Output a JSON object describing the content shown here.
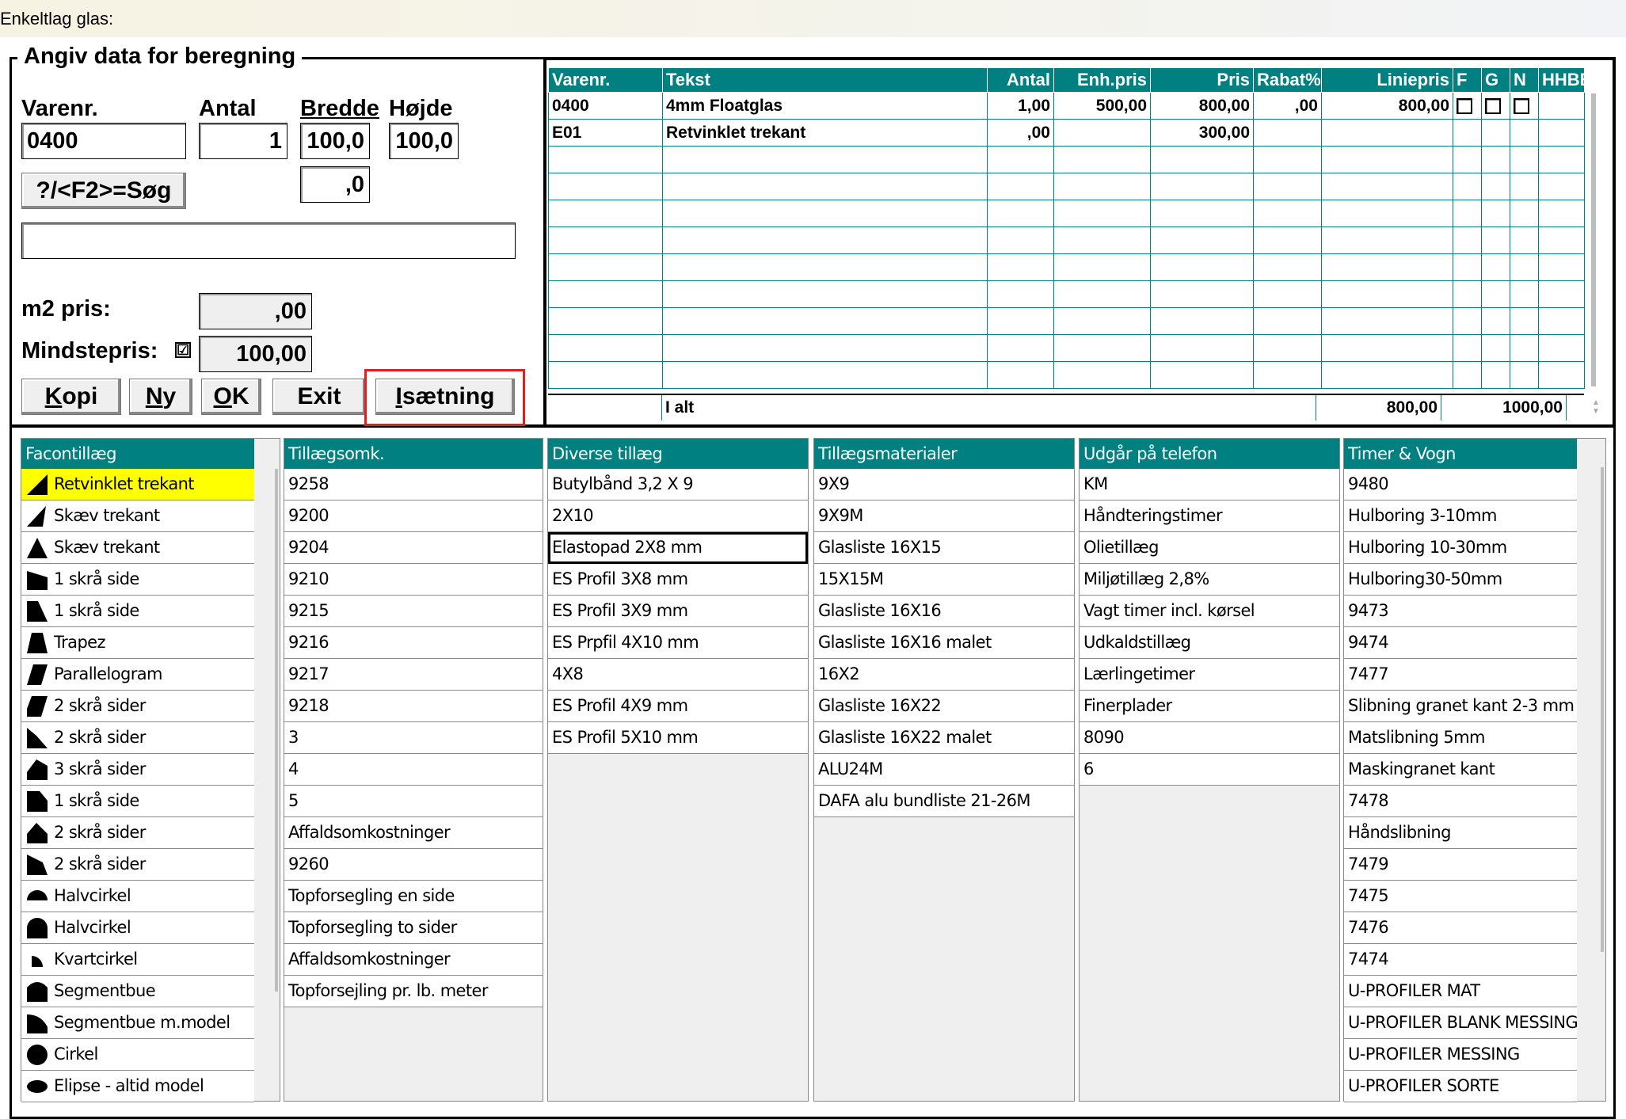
{
  "window": {
    "title": "Enkeltlag glas:"
  },
  "form": {
    "legend": "Angiv data for beregning",
    "labels": {
      "varenr": "Varenr.",
      "antal": "Antal",
      "bredde": "Bredde",
      "hojde": "Højde",
      "m2pris": "m2 pris:",
      "mindstepris": "Mindstepris:"
    },
    "values": {
      "varenr": "0400",
      "antal": "1",
      "bredde": "100,0",
      "hojde": "100,0",
      "extra": ",0",
      "note": "",
      "m2pris": ",00",
      "mindstepris": "100,00",
      "mindstepris_checked": "☑"
    },
    "buttons": {
      "search": "?/<F2>=Søg",
      "kopi": "Kopi",
      "ny": "Ny",
      "ok": "OK",
      "exit": "Exit",
      "isaetning": "Isætning"
    }
  },
  "grid": {
    "headers": [
      "Varenr.",
      "Tekst",
      "Antal",
      "Enh.pris",
      "Pris",
      "Rabat%",
      "Liniepris",
      "F",
      "G",
      "N",
      "HHBB"
    ],
    "rows": [
      {
        "varenr": "0400",
        "tekst": "4mm Floatglas",
        "antal": "1,00",
        "enhpris": "500,00",
        "pris": "800,00",
        "rabat": ",00",
        "liniepris": "800,00",
        "checks": true
      },
      {
        "varenr": "E01",
        "tekst": "Retvinklet trekant",
        "antal": ",00",
        "enhpris": "",
        "pris": "300,00",
        "rabat": "",
        "liniepris": "",
        "checks": false
      }
    ],
    "empty_rows": 9,
    "totals": {
      "label": "I alt",
      "sum1": "800,00",
      "sum2": "1000,00"
    }
  },
  "lists": {
    "facontillaeg": {
      "title": "Facontillæg",
      "items": [
        {
          "label": "Retvinklet trekant",
          "shape": "tri-right",
          "selected": true
        },
        {
          "label": "Skæv trekant",
          "shape": "tri-skew"
        },
        {
          "label": "Skæv trekant",
          "shape": "tri-iso"
        },
        {
          "label": "1 skrå side",
          "shape": "one-slant-a"
        },
        {
          "label": "1 skrå side",
          "shape": "one-slant-b"
        },
        {
          "label": "Trapez",
          "shape": "trapez"
        },
        {
          "label": "Parallelogram",
          "shape": "parallel"
        },
        {
          "label": "2 skrå sider",
          "shape": "two-slant-a"
        },
        {
          "label": "2 skrå sider",
          "shape": "two-slant-b"
        },
        {
          "label": "3 skrå sider",
          "shape": "three-slant"
        },
        {
          "label": "1 skrå side",
          "shape": "one-slant-c"
        },
        {
          "label": "2 skrå sider",
          "shape": "two-slant-c"
        },
        {
          "label": "2 skrå sider",
          "shape": "two-slant-d"
        },
        {
          "label": "Halvcirkel",
          "shape": "half-circle-flat"
        },
        {
          "label": "Halvcirkel",
          "shape": "half-circle"
        },
        {
          "label": "Kvartcirkel",
          "shape": "quarter-circle"
        },
        {
          "label": "Segmentbue",
          "shape": "segment"
        },
        {
          "label": "Segmentbue m.model",
          "shape": "segment-model"
        },
        {
          "label": "Cirkel",
          "shape": "circle"
        },
        {
          "label": "Elipse - altid model",
          "shape": "ellipse"
        }
      ]
    },
    "tillaegsomk": {
      "title": "Tillægsomk.",
      "items": [
        "9258",
        "9200",
        "9204",
        "9210",
        "9215",
        "9216",
        "9217",
        "9218",
        "3",
        "4",
        "5",
        "Affaldsomkostninger",
        "9260",
        "Topforsegling en side",
        "Topforsegling to sider",
        "Affaldsomkostninger",
        "Topforsejling pr. lb. meter"
      ]
    },
    "diverse": {
      "title": "Diverse tillæg",
      "items": [
        "Butylbånd 3,2 X 9",
        "2X10",
        "Elastopad 2X8 mm",
        "ES Profil 3X8 mm",
        "ES Profil 3X9 mm",
        "ES Prpfil 4X10 mm",
        "4X8",
        "ES Profil 4X9 mm",
        "ES Profil 5X10 mm"
      ],
      "focused_index": 2
    },
    "materialer": {
      "title": "Tillægsmaterialer",
      "items": [
        "9X9",
        "9X9M",
        "Glasliste 16X15",
        "15X15M",
        "Glasliste 16X16",
        "Glasliste 16X16 malet",
        "16X2",
        "Glasliste 16X22",
        "Glasliste 16X22 malet",
        "ALU24M",
        "DAFA alu bundliste 21-26M"
      ]
    },
    "telefon": {
      "title": "Udgår på telefon",
      "items": [
        "KM",
        "Håndteringstimer",
        "Olietillæg",
        "Miljøtillæg 2,8%",
        "Vagt timer incl. kørsel",
        "Udkaldstillæg",
        "Lærlingetimer",
        "Finerplader",
        "8090",
        "6"
      ]
    },
    "timer": {
      "title": "Timer & Vogn",
      "items": [
        "9480",
        "Hulboring 3-10mm",
        "Hulboring 10-30mm",
        "Hulboring30-50mm",
        "9473",
        "9474",
        "7477",
        "Slibning granet kant 2-3 mm",
        "Matslibning 5mm",
        "Maskingranet kant",
        "7478",
        "Håndslibning",
        "7479",
        "7475",
        "7476",
        "7474",
        "U-PROFILER MAT",
        "U-PROFILER BLANK MESSING",
        "U-PROFILER MESSING",
        "U-PROFILER SORTE"
      ]
    }
  },
  "colors": {
    "header_teal": "#008080",
    "selected_yellow": "#ffff00",
    "focus_red": "#e02020"
  }
}
